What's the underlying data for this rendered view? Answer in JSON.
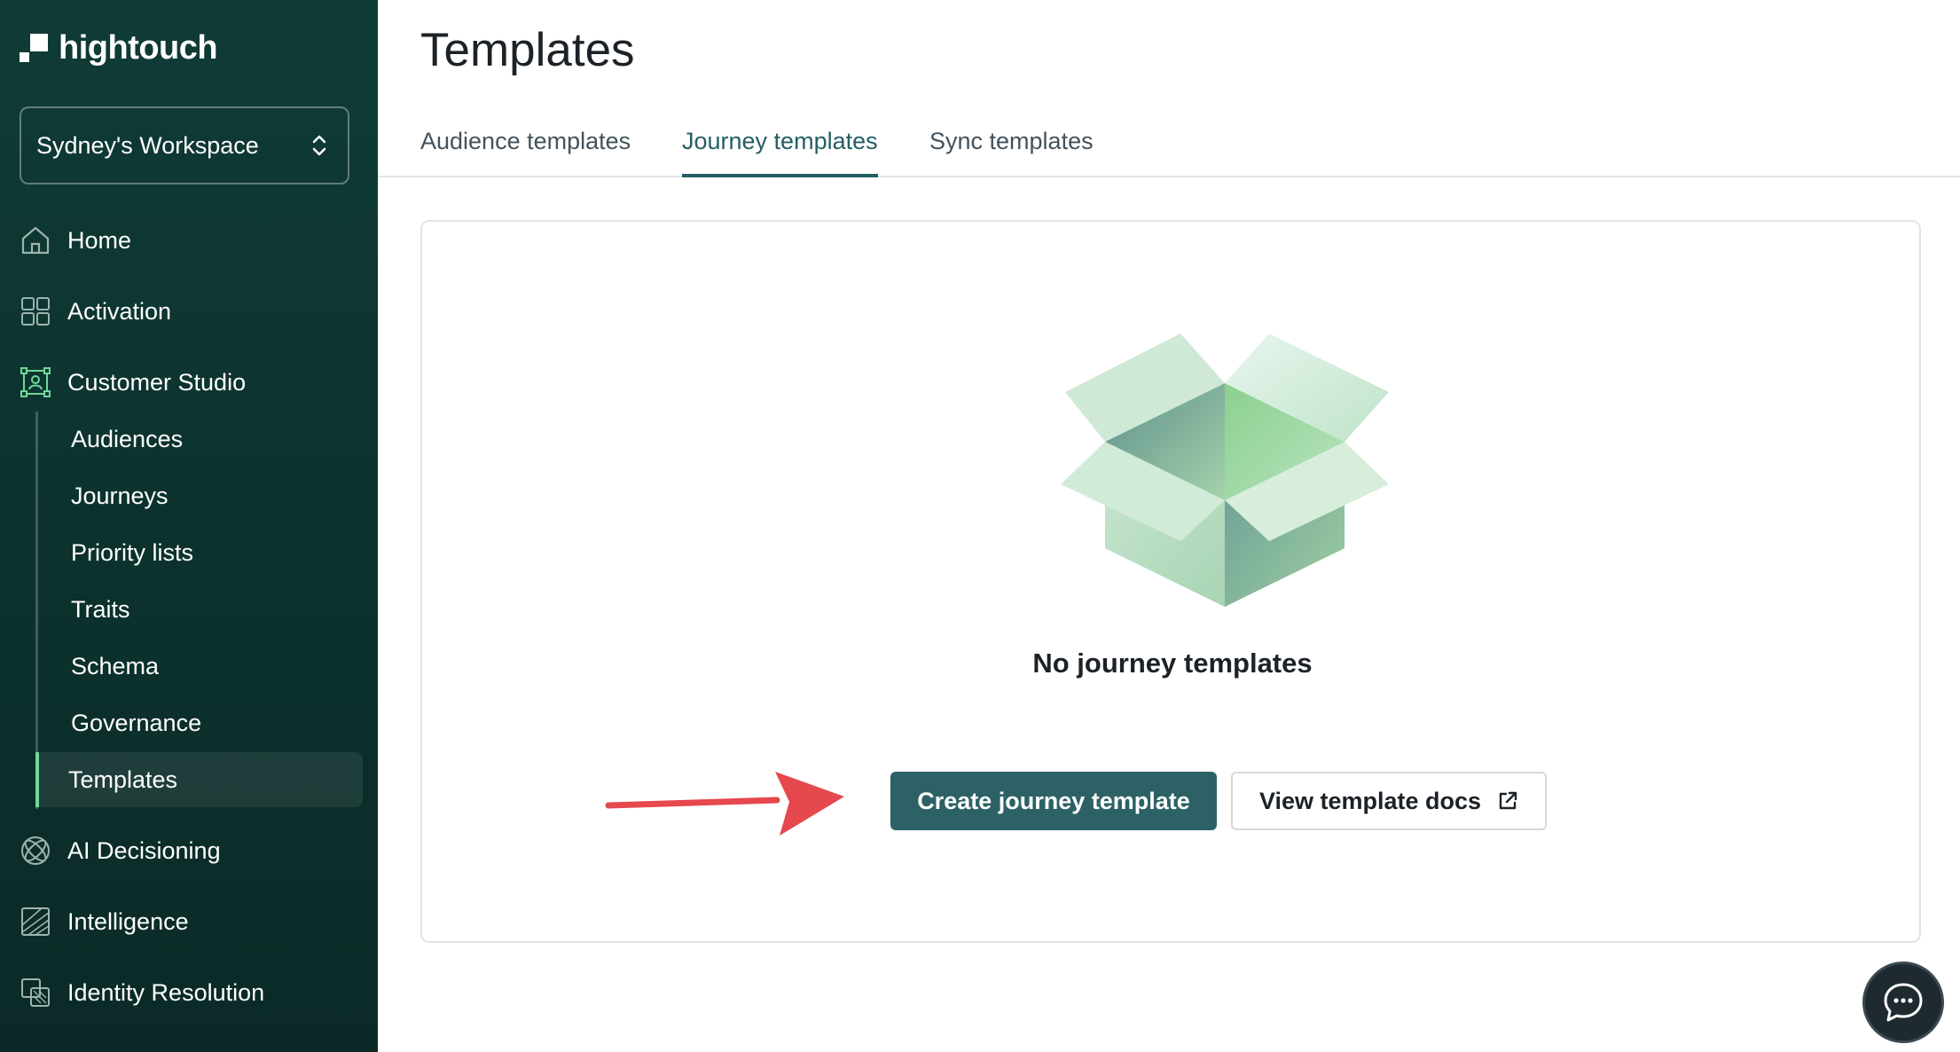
{
  "brand": {
    "name": "hightouch"
  },
  "workspace": {
    "name": "Sydney's Workspace"
  },
  "sidebar": {
    "items": [
      {
        "label": "Home",
        "icon": "home-icon"
      },
      {
        "label": "Activation",
        "icon": "activation-icon"
      },
      {
        "label": "Customer Studio",
        "icon": "customer-studio-icon"
      },
      {
        "label": "AI Decisioning",
        "icon": "ai-decisioning-icon"
      },
      {
        "label": "Intelligence",
        "icon": "intelligence-icon"
      },
      {
        "label": "Identity Resolution",
        "icon": "identity-resolution-icon"
      }
    ],
    "sub_items": [
      {
        "label": "Audiences"
      },
      {
        "label": "Journeys"
      },
      {
        "label": "Priority lists"
      },
      {
        "label": "Traits"
      },
      {
        "label": "Schema"
      },
      {
        "label": "Governance"
      },
      {
        "label": "Templates",
        "active": true
      }
    ]
  },
  "page": {
    "title": "Templates"
  },
  "tabs": [
    {
      "label": "Audience templates"
    },
    {
      "label": "Journey templates",
      "active": true
    },
    {
      "label": "Sync templates"
    }
  ],
  "empty_state": {
    "title": "No journey templates",
    "primary_button": "Create journey template",
    "secondary_button": "View template docs"
  },
  "colors": {
    "sidebar_bg": "#0f3b36",
    "accent": "#245f63",
    "primary_button": "#2c6265",
    "annotation_arrow": "#e5484d"
  }
}
